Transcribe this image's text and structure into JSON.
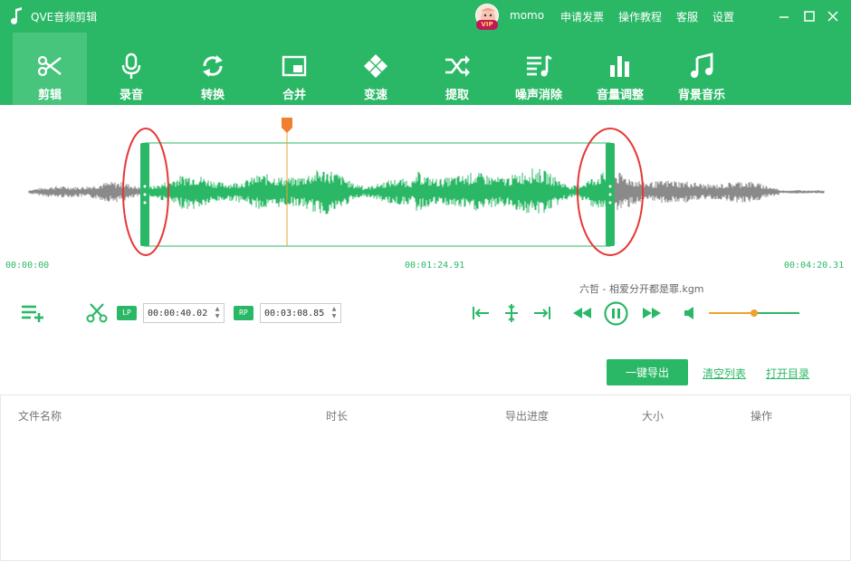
{
  "app": {
    "title": "QVE音频剪辑"
  },
  "user": {
    "name": "momo",
    "badge": "VIP"
  },
  "top_links": {
    "invoice": "申请发票",
    "tutorial": "操作教程",
    "support": "客服",
    "settings": "设置"
  },
  "toolbar": [
    {
      "label": "剪辑",
      "icon": "scissors-icon",
      "active": true
    },
    {
      "label": "录音",
      "icon": "microphone-icon"
    },
    {
      "label": "转换",
      "icon": "convert-icon"
    },
    {
      "label": "合并",
      "icon": "merge-icon"
    },
    {
      "label": "变速",
      "icon": "speed-icon"
    },
    {
      "label": "提取",
      "icon": "shuffle-icon"
    },
    {
      "label": "噪声消除",
      "icon": "music-list-icon"
    },
    {
      "label": "音量调整",
      "icon": "volume-bars-icon"
    },
    {
      "label": "背景音乐",
      "icon": "music-note-icon"
    }
  ],
  "waveform": {
    "start_time": "00:00:00",
    "playhead_time": "00:01:24.91",
    "end_time": "00:04:20.31"
  },
  "now_playing": "六哲 - 相爱分开都是罪.kgm",
  "clip": {
    "lp_label": "LP",
    "lp_value": "00:00:40.02",
    "rp_label": "RP",
    "rp_value": "00:03:08.85"
  },
  "volume_level": 0.5,
  "actions": {
    "export": "一键导出",
    "clear": "清空列表",
    "open_dir": "打开目录"
  },
  "table": {
    "columns": [
      "文件名称",
      "时长",
      "导出进度",
      "大小",
      "操作"
    ]
  },
  "colors": {
    "primary": "#2bb866",
    "accent_orange": "#f0a030",
    "highlight_red": "#e53935",
    "wave_gray": "#8a8a8a"
  }
}
